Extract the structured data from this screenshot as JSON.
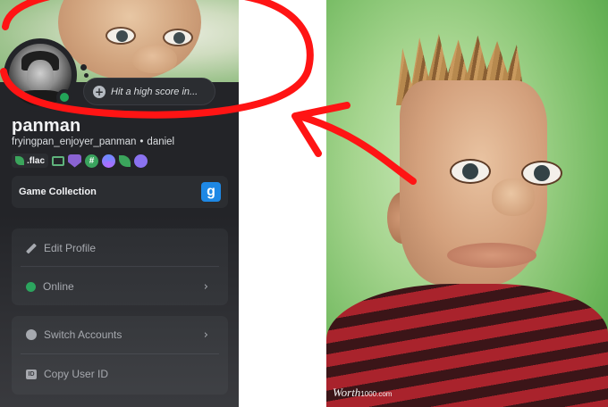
{
  "profile": {
    "custom_status_placeholder": "Hit a high score in...",
    "display_name": "panman",
    "username": "fryingpan_enjoyer_panman",
    "pronouns": "daniel",
    "separator": "•",
    "clan_tag": ".flac",
    "status_color": "#23a559",
    "badges": [
      "monitor-icon",
      "shield-icon",
      "hash-icon",
      "gear-icon",
      "leaf-icon",
      "nitro-icon"
    ]
  },
  "game_collection": {
    "label": "Game Collection",
    "icon_letter": "g"
  },
  "menu": {
    "edit_profile": "Edit Profile",
    "online": "Online",
    "switch_accounts": "Switch Accounts",
    "copy_user_id": "Copy User ID",
    "id_icon_text": "ID"
  },
  "watermark": {
    "brand": "Worth",
    "suffix": "1000.com"
  },
  "colors": {
    "annotation_red": "#ff1414",
    "panel_bg": "#232428",
    "card_bg": "#2b2d31"
  }
}
